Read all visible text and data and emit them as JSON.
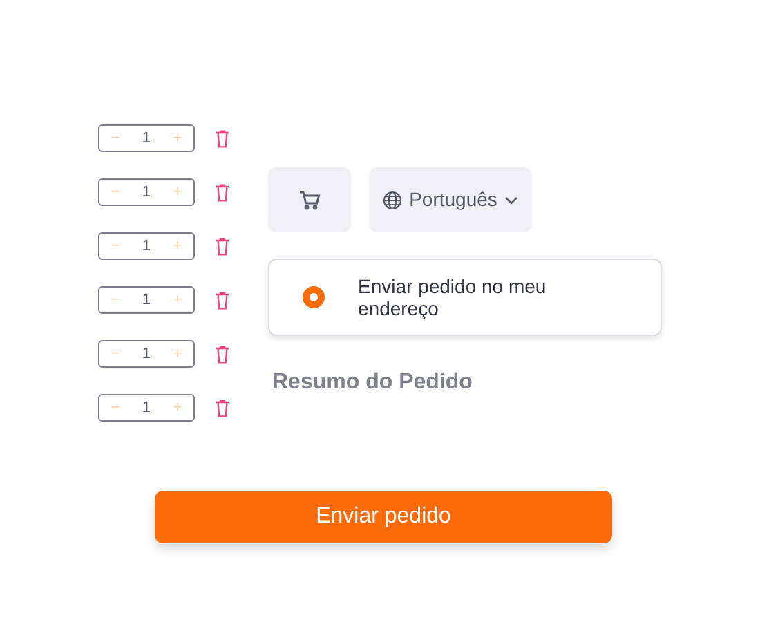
{
  "cart_items": [
    {
      "decrement": "−",
      "quantity": "1",
      "increment": "+"
    },
    {
      "decrement": "−",
      "quantity": "1",
      "increment": "+"
    },
    {
      "decrement": "−",
      "quantity": "1",
      "increment": "+"
    },
    {
      "decrement": "−",
      "quantity": "1",
      "increment": "+"
    },
    {
      "decrement": "−",
      "quantity": "1",
      "increment": "+"
    },
    {
      "decrement": "−",
      "quantity": "1",
      "increment": "+"
    }
  ],
  "language_button": {
    "label": "Português"
  },
  "delivery_options": [
    {
      "label": "Enviar pedido no meu endereço",
      "selected": true
    }
  ],
  "summary_heading": "Resumo do Pedido",
  "submit_button": {
    "label": "Enviar pedido"
  }
}
